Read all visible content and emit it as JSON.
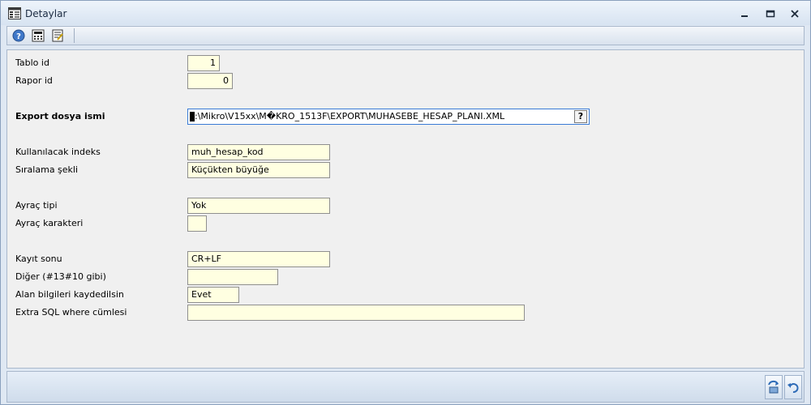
{
  "window": {
    "title": "Detaylar",
    "icon": "form-grid-icon"
  },
  "toolbar": {
    "buttons": [
      "help-icon",
      "calculator-icon",
      "print-setup-icon"
    ]
  },
  "form": {
    "tablo_id": {
      "label": "Tablo id",
      "value": "1"
    },
    "rapor_id": {
      "label": "Rapor id",
      "value": "0"
    },
    "export_file": {
      "label": "Export dosya ismi",
      "value": ":\\Mikro\\V15xx\\M�KRO_1513F\\EXPORT\\MUHASEBE_HESAP_PLANI.XML",
      "lookup_label": "?"
    },
    "index": {
      "label": "Kullanılacak indeks",
      "value": "muh_hesap_kod"
    },
    "sort": {
      "label": "Sıralama şekli",
      "value": "Küçükten büyüğe"
    },
    "separator_type": {
      "label": "Ayraç tipi",
      "value": "Yok"
    },
    "separator_char": {
      "label": "Ayraç karakteri",
      "value": ""
    },
    "record_end": {
      "label": "Kayıt sonu",
      "value": "CR+LF"
    },
    "other": {
      "label": "Diğer (#13#10 gibi)",
      "value": ""
    },
    "save_fields": {
      "label": "Alan bilgileri kaydedilsin",
      "value": "Evet"
    },
    "extra_sql": {
      "label": "Extra SQL where cümlesi",
      "value": ""
    }
  },
  "footer": {
    "buttons": [
      "save-icon",
      "undo-icon"
    ]
  },
  "colors": {
    "field_bg": "#ffffe1",
    "panel_bg": "#f0f0f0",
    "frame_bg": "#dfe8f3"
  }
}
